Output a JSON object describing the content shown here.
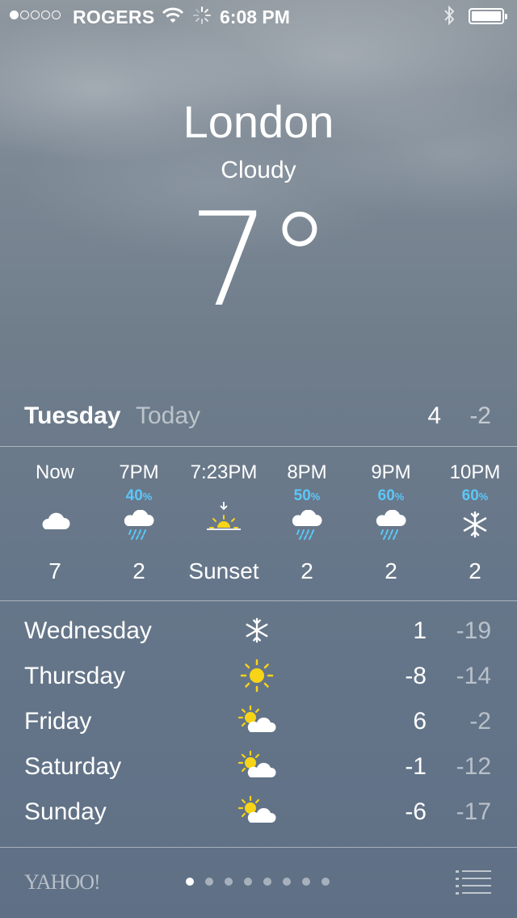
{
  "status_bar": {
    "signal_dots": 5,
    "signal_filled": 1,
    "carrier": "ROGERS",
    "time": "6:08 PM",
    "icons": [
      "wifi-icon",
      "activity-spinner-icon",
      "bluetooth-icon",
      "battery-icon"
    ],
    "battery_level": 1.0
  },
  "location": {
    "city": "London",
    "condition": "Cloudy",
    "temperature": "7°"
  },
  "today": {
    "day": "Tuesday",
    "label": "Today",
    "high": "4",
    "low": "-2"
  },
  "hourly": [
    {
      "time": "Now",
      "precip": "",
      "precip_unit": "",
      "icon": "cloud-icon",
      "value": "7"
    },
    {
      "time": "7PM",
      "precip": "40",
      "precip_unit": "%",
      "icon": "rain-cloud-icon",
      "value": "2"
    },
    {
      "time": "7:23PM",
      "precip": "",
      "precip_unit": "",
      "icon": "sunset-icon",
      "value": "Sunset"
    },
    {
      "time": "8PM",
      "precip": "50",
      "precip_unit": "%",
      "icon": "rain-cloud-icon",
      "value": "2"
    },
    {
      "time": "9PM",
      "precip": "60",
      "precip_unit": "%",
      "icon": "rain-cloud-icon",
      "value": "2"
    },
    {
      "time": "10PM",
      "precip": "60",
      "precip_unit": "%",
      "icon": "snowflake-icon",
      "value": "2"
    }
  ],
  "daily": [
    {
      "day": "Wednesday",
      "icon": "snowflake-icon",
      "high": "1",
      "low": "-19"
    },
    {
      "day": "Thursday",
      "icon": "sun-icon",
      "high": "-8",
      "low": "-14"
    },
    {
      "day": "Friday",
      "icon": "partly-cloudy-icon",
      "high": "6",
      "low": "-2"
    },
    {
      "day": "Saturday",
      "icon": "partly-cloudy-icon",
      "high": "-1",
      "low": "-12"
    },
    {
      "day": "Sunday",
      "icon": "partly-cloudy-icon",
      "high": "-6",
      "low": "-17"
    }
  ],
  "footer": {
    "brand": "YAHOO!",
    "page_count": 8,
    "active_page": 1,
    "list_icon": "list-icon"
  },
  "colors": {
    "precip_blue": "#5ac8fa",
    "sun_yellow": "#f7d417",
    "background_top": "#8f979f",
    "background_bottom": "#5f7086"
  }
}
